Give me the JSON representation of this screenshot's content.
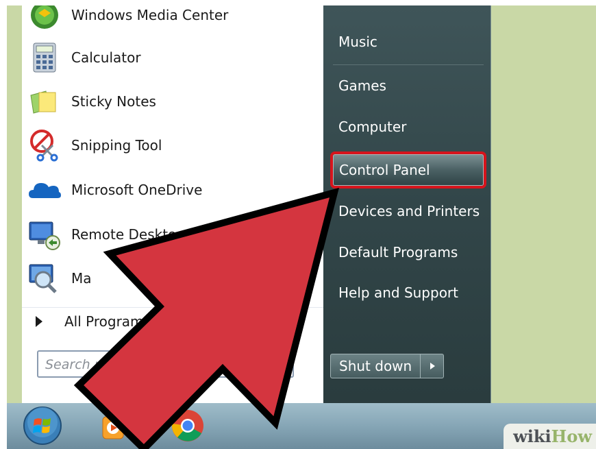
{
  "start_menu": {
    "left_items": [
      {
        "label": "Windows Media Center",
        "icon": "media-center-icon"
      },
      {
        "label": "Calculator",
        "icon": "calculator-icon"
      },
      {
        "label": "Sticky Notes",
        "icon": "sticky-notes-icon"
      },
      {
        "label": "Snipping Tool",
        "icon": "snipping-tool-icon"
      },
      {
        "label": "Microsoft OneDrive",
        "icon": "onedrive-icon"
      },
      {
        "label": "Remote Desktop Co",
        "icon": "remote-desktop-icon"
      },
      {
        "label": "Ma",
        "icon": "magnifier-icon"
      }
    ],
    "all_programs_label": "All Programs",
    "search": {
      "placeholder": "Search p         le"
    },
    "right_items": [
      {
        "label": "Music"
      },
      {
        "label": "Games"
      },
      {
        "label": "Computer"
      },
      {
        "label": "Control Panel"
      },
      {
        "label": "Devices and Printers"
      },
      {
        "label": "Default Programs"
      },
      {
        "label": "Help and Support"
      }
    ],
    "shutdown_label": "Shut down"
  },
  "taskbar": {
    "items": [
      {
        "icon": "windows-start-orb-icon"
      },
      {
        "icon": "media-player-icon"
      },
      {
        "icon": "chrome-icon"
      }
    ]
  },
  "highlight_color": "#d6141c",
  "arrow_color": "#d4353f",
  "watermark": {
    "part1": "wiki",
    "part2": "How"
  }
}
